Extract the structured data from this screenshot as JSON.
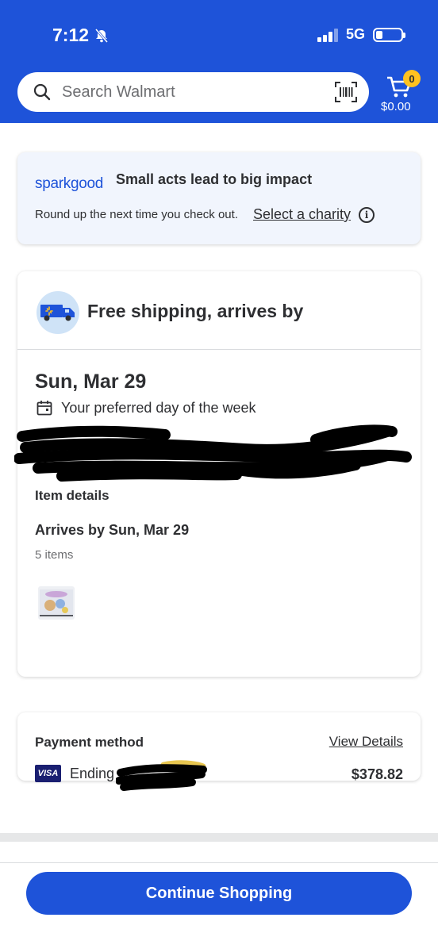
{
  "status_bar": {
    "time": "7:12",
    "network": "5G"
  },
  "header": {
    "search_placeholder": "Search Walmart",
    "cart_count": "0",
    "cart_total": "$0.00"
  },
  "sparkgood": {
    "logo_spark": "spark",
    "logo_good": "good",
    "title": "Small acts lead to big impact",
    "subtitle": "Round up the next time you check out.",
    "link": "Select a charity"
  },
  "shipping": {
    "title": "Free shipping, arrives by",
    "date": "Sun, Mar 29",
    "preferred_day": "Your preferred day of the week",
    "item_details": "Item details",
    "arrives_by": "Arrives by Sun, Mar 29",
    "item_count": "5 items"
  },
  "payment": {
    "title": "Payment method",
    "view_details": "View Details",
    "card_brand": "VISA",
    "ending": "Ending",
    "amount": "$378.82"
  },
  "continue_button": "Continue Shopping",
  "colors": {
    "brand_blue": "#1e53d9",
    "badge_yellow": "#ffc220",
    "spark_bg": "#f1f5fd"
  }
}
